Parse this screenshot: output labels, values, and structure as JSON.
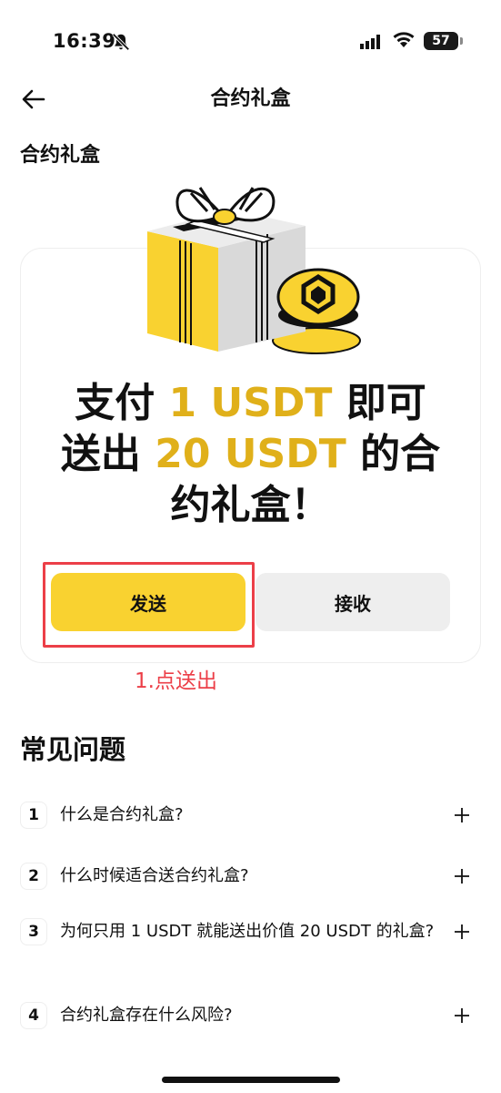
{
  "status_bar": {
    "time": "16:39",
    "battery": "57"
  },
  "nav": {
    "title": "合约礼盒"
  },
  "section": {
    "title": "合约礼盒"
  },
  "hero": {
    "line1_pre": "支付 ",
    "line1_amount": "1 USDT",
    "line1_post": " 即可",
    "line2_pre": "送出 ",
    "line2_amount": "20 USDT",
    "line2_post": " 的合",
    "line3": "约礼盒！"
  },
  "buttons": {
    "send": "发送",
    "receive": "接收"
  },
  "annotation": "1.点送出",
  "faq": {
    "title": "常见问题",
    "items": [
      {
        "num": "1",
        "text": "什么是合约礼盒?"
      },
      {
        "num": "2",
        "text": "什么时候适合送合约礼盒?"
      },
      {
        "num": "3",
        "text": "为何只用 1 USDT 就能送出价值 20 USDT 的礼盒?"
      },
      {
        "num": "4",
        "text": "合约礼盒存在什么风险?"
      }
    ]
  },
  "colors": {
    "accent": "#f9d230",
    "highlight_text": "#e0b01a",
    "annotation": "#ec3f48"
  }
}
